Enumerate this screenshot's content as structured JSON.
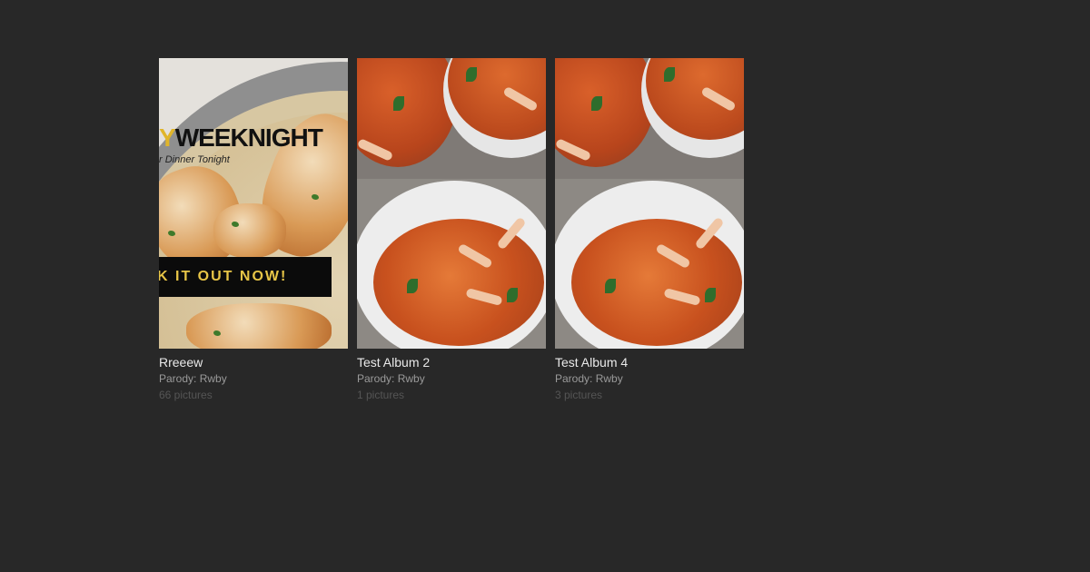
{
  "albums": [
    {
      "title": "Rreeew",
      "parody": "Parody: Rwby",
      "count": "66 pictures",
      "thumb": {
        "headline_gold": "Y",
        "headline": "WEEKNIGHT",
        "subline": "r Dinner Tonight",
        "banner": "K IT OUT NOW!"
      }
    },
    {
      "title": "Test Album 2",
      "parody": "Parody: Rwby",
      "count": "1 pictures"
    },
    {
      "title": "Test Album 4",
      "parody": "Parody: Rwby",
      "count": "3 pictures"
    }
  ],
  "colors": {
    "background": "#282828",
    "title": "#e9e9e9",
    "parody": "#9a9a9a",
    "count": "#555555",
    "banner_text": "#e7c547"
  }
}
